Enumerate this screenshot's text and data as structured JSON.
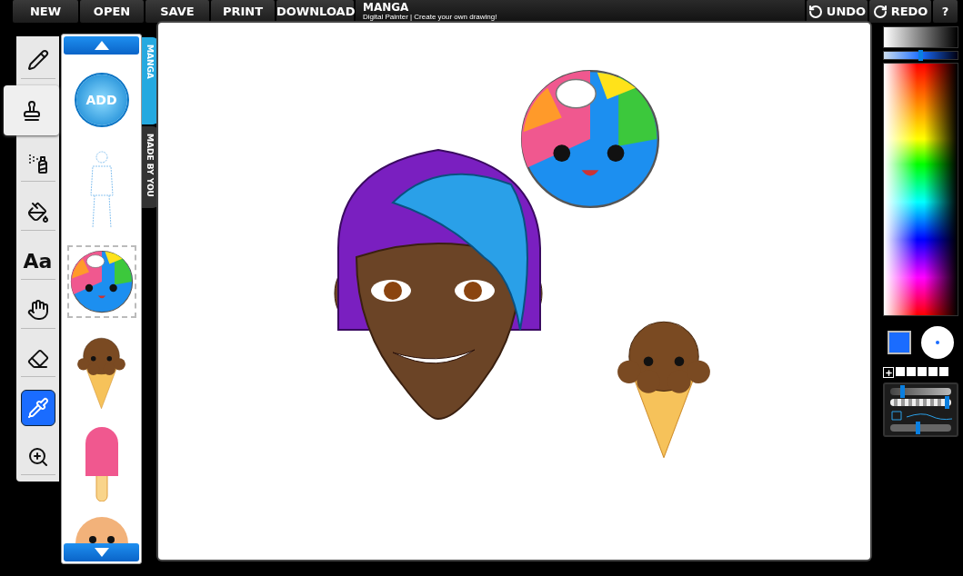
{
  "menu": [
    {
      "label": "NEW"
    },
    {
      "label": "OPEN"
    },
    {
      "label": "SAVE"
    },
    {
      "label": "PRINT"
    },
    {
      "label": "DOWNLOAD"
    }
  ],
  "app": {
    "title": "MANGA",
    "subtitle": "Digital Painter | Create your own drawing!"
  },
  "history": [
    {
      "kind": "undo",
      "label": "UNDO"
    },
    {
      "kind": "redo",
      "label": "REDO"
    },
    {
      "kind": "help",
      "label": "?"
    }
  ],
  "tools": [
    {
      "kind": "pencil",
      "selected": false,
      "active": false
    },
    {
      "kind": "stamp",
      "selected": true,
      "active": false
    },
    {
      "kind": "spray",
      "selected": false,
      "active": false
    },
    {
      "kind": "fill",
      "selected": false,
      "active": false
    },
    {
      "kind": "text",
      "label": "Aa",
      "selected": false,
      "active": false
    },
    {
      "kind": "move",
      "selected": false,
      "active": false
    },
    {
      "kind": "eraser",
      "selected": false,
      "active": false
    },
    {
      "kind": "picker",
      "selected": false,
      "active": true
    },
    {
      "kind": "zoom",
      "selected": false,
      "active": false
    }
  ],
  "stamps": [
    {
      "kind": "add",
      "label": "ADD",
      "selected": false
    },
    {
      "kind": "figure",
      "selected": false
    },
    {
      "kind": "ball",
      "selected": true
    },
    {
      "kind": "icecream",
      "selected": false
    },
    {
      "kind": "popsicle",
      "selected": false
    },
    {
      "kind": "cookie",
      "selected": false
    }
  ],
  "categories": [
    {
      "label": "MANGA",
      "selected": true
    },
    {
      "label": "MADE BY YOU",
      "selected": false
    }
  ],
  "shade": {
    "level": 0.5
  },
  "brush": {
    "size": {
      "level": 0.17
    },
    "opacity": {
      "level": 0.97
    },
    "smoothing": {
      "level": 0.45
    }
  }
}
